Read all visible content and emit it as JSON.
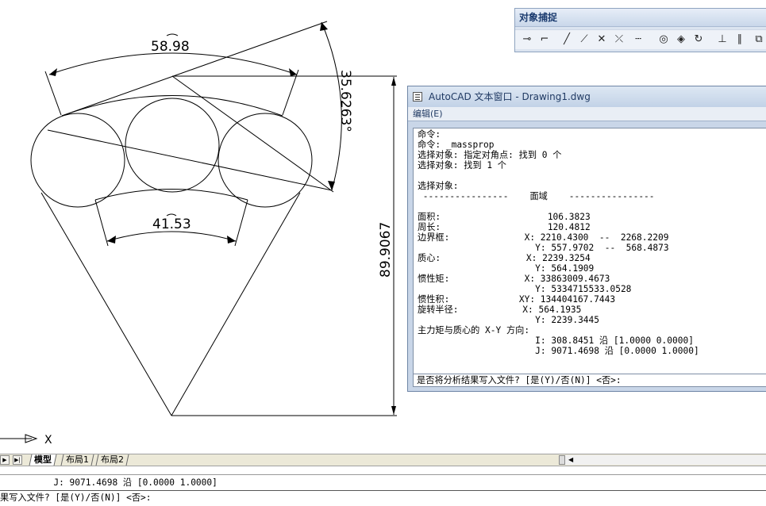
{
  "drawing": {
    "dim_top_arc": "58.98",
    "dim_angle": "35.6263°",
    "dim_bottom_arc": "41.53",
    "dim_vertical": "89.9067",
    "ucs_x_label": "X"
  },
  "osnap_toolbar": {
    "title": "对象捕捉",
    "icons": [
      "temp-track-icon",
      "snap-from-icon",
      "endpoint-icon",
      "midpoint-icon",
      "intersection-icon",
      "apparent-intersection-icon",
      "extension-icon",
      "center-icon",
      "quadrant-icon",
      "tangent-icon",
      "perpendicular-icon",
      "parallel-icon",
      "insert-icon"
    ]
  },
  "text_window": {
    "title": "AutoCAD 文本窗口 - Drawing1.dwg",
    "menu_edit": "编辑(E)",
    "lines": [
      "命令:",
      "命令: _massprop",
      "选择对象: 指定对角点: 找到 0 个",
      "选择对象: 找到 1 个",
      "",
      "选择对象:",
      " ----------------    面域    ----------------",
      "",
      "面积:                    106.3823",
      "周长:                    120.4812",
      "边界框:              X: 2210.4300  --  2268.2209",
      "                      Y: 557.9702  --  568.4873",
      "质心:                X: 2239.3254",
      "                      Y: 564.1909",
      "惯性矩:              X: 33863009.4673",
      "                      Y: 5334715533.0528",
      "惯性积:             XY: 134404167.7443",
      "旋转半径:            X: 564.1935",
      "                      Y: 2239.3445",
      "主力矩与质心的 X-Y 方向:",
      "                      I: 308.8451 沿 [1.0000 0.0000]",
      "                      J: 9071.4698 沿 [0.0000 1.0000]"
    ],
    "prompt": "是否将分析结果写入文件? [是(Y)/否(N)] <否>:"
  },
  "tabs": {
    "items": [
      "模型",
      "布局1",
      "布局2"
    ],
    "active": "模型"
  },
  "command_line": {
    "line1": "          J: 9071.4698 沿 [0.0000 1.0000]",
    "line2": "果写入文件? [是(Y)/否(N)] <否>:"
  }
}
